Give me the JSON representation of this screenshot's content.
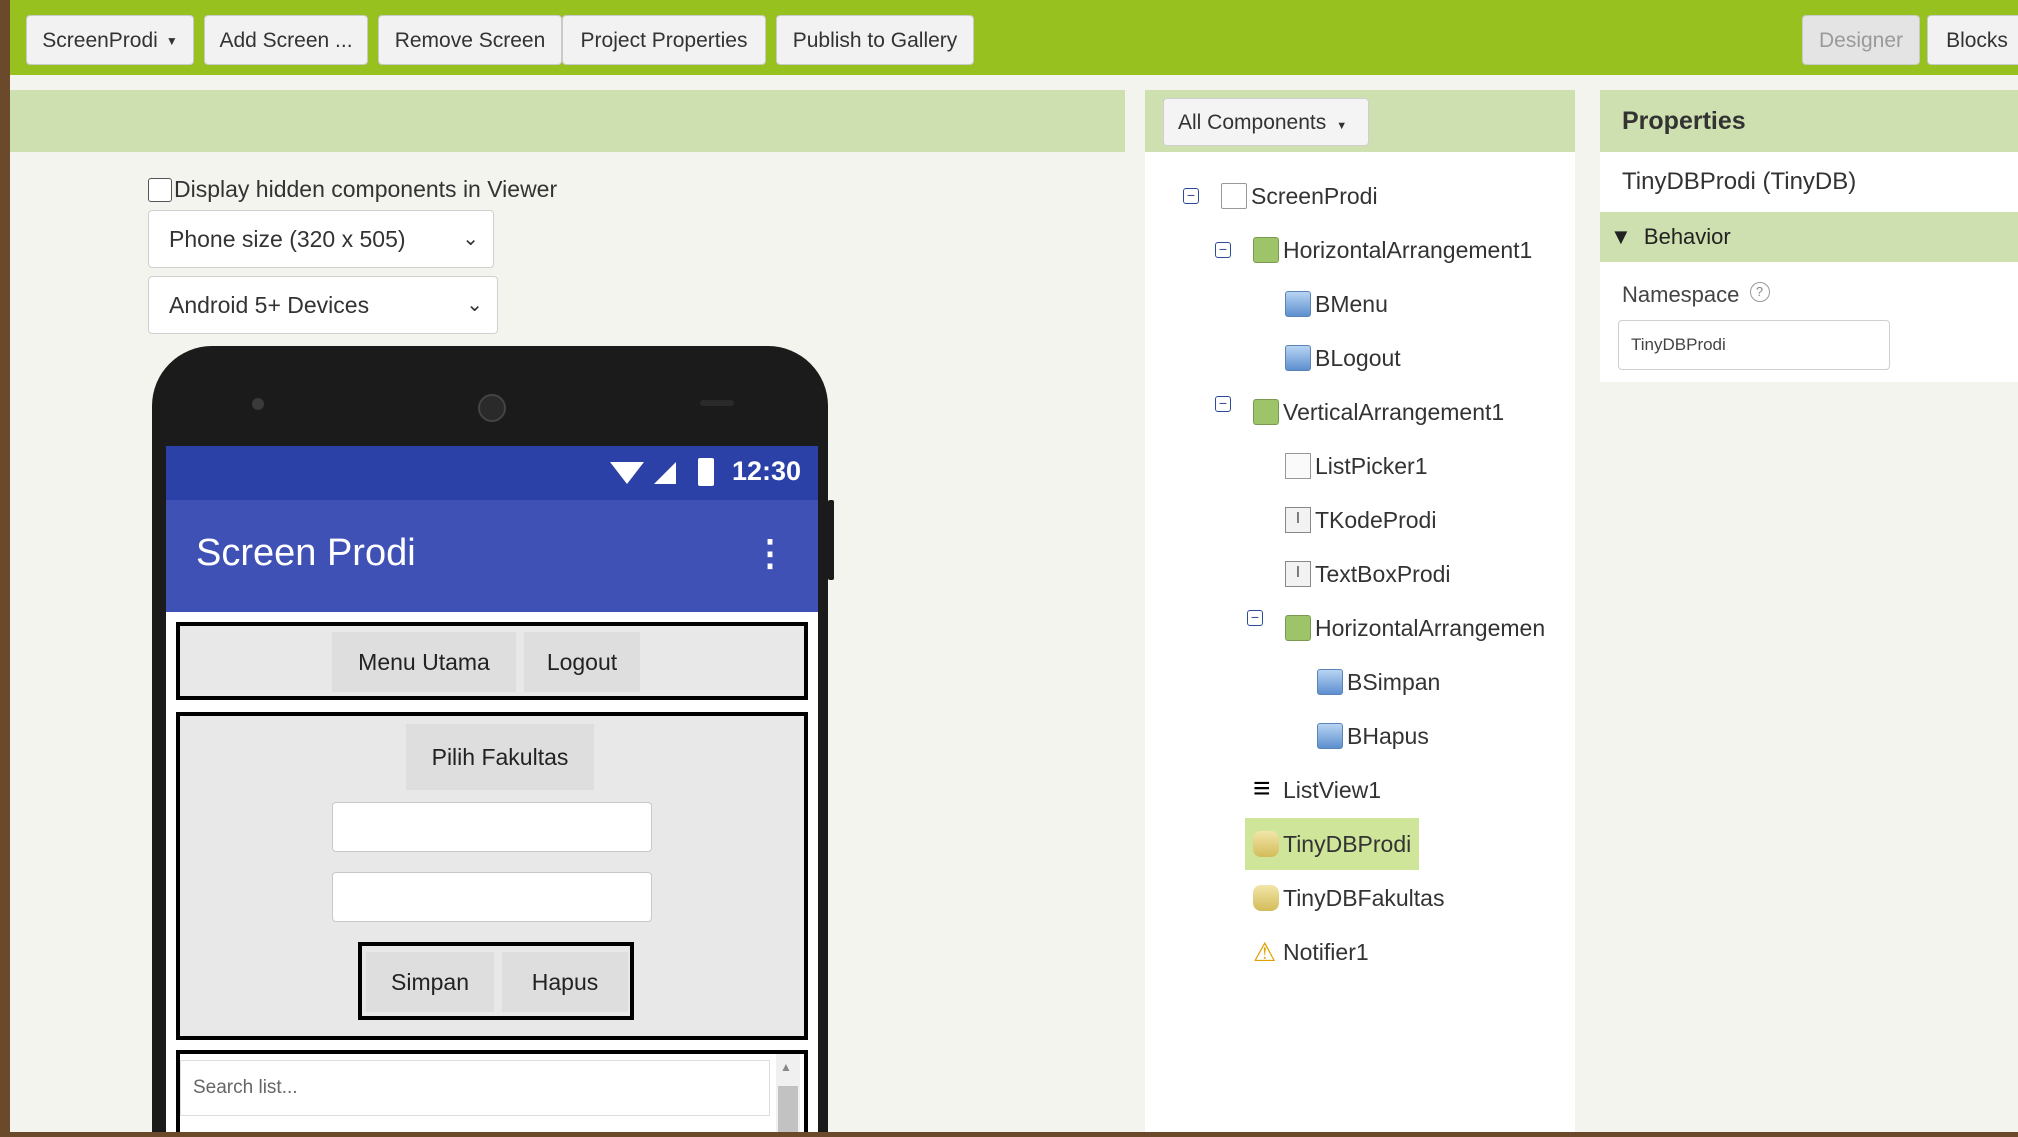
{
  "toolbar": {
    "screen_select": "ScreenProdi",
    "add_screen": "Add Screen ...",
    "remove_screen": "Remove Screen",
    "project_properties": "Project Properties",
    "publish_gallery": "Publish to Gallery",
    "designer": "Designer",
    "blocks": "Blocks"
  },
  "viewer": {
    "display_hidden_label": "Display hidden components in Viewer",
    "display_hidden_checked": false,
    "phone_size": "Phone size (320 x 505)",
    "android_version": "Android 5+ Devices"
  },
  "phone": {
    "clock": "12:30",
    "app_title": "Screen Prodi",
    "menu_utama": "Menu Utama",
    "logout": "Logout",
    "pilih_fakultas": "Pilih Fakultas",
    "simpan": "Simpan",
    "hapus": "Hapus",
    "search_placeholder": "Search list..."
  },
  "components": {
    "filter": "All Components",
    "tree": [
      {
        "label": "ScreenProdi",
        "icon": "screen-icon"
      },
      {
        "label": "HorizontalArrangement1",
        "icon": "horizontal-arrangement-icon"
      },
      {
        "label": "BMenu",
        "icon": "button-icon"
      },
      {
        "label": "BLogout",
        "icon": "button-icon"
      },
      {
        "label": "VerticalArrangement1",
        "icon": "vertical-arrangement-icon"
      },
      {
        "label": "ListPicker1",
        "icon": "listpicker-icon"
      },
      {
        "label": "TKodeProdi",
        "icon": "textbox-icon"
      },
      {
        "label": "TextBoxProdi",
        "icon": "textbox-icon"
      },
      {
        "label": "HorizontalArrangemen",
        "icon": "horizontal-arrangement-icon"
      },
      {
        "label": "BSimpan",
        "icon": "button-icon"
      },
      {
        "label": "BHapus",
        "icon": "button-icon"
      },
      {
        "label": "ListView1",
        "icon": "listview-icon"
      },
      {
        "label": "TinyDBProdi",
        "icon": "tinydb-icon",
        "selected": true
      },
      {
        "label": "TinyDBFakultas",
        "icon": "tinydb-icon"
      },
      {
        "label": "Notifier1",
        "icon": "notifier-icon"
      }
    ]
  },
  "properties": {
    "title": "Properties",
    "component": "TinyDBProdi (TinyDB)",
    "section": "Behavior",
    "namespace_label": "Namespace",
    "namespace_help": "?",
    "namespace_value": "TinyDBProdi"
  },
  "colors": {
    "toolbar_green": "#96c11f",
    "header_green": "#cfe0b0",
    "phone_status": "#2c41a7",
    "phone_appbar": "#3f51b5",
    "selected_node": "#cfe59a"
  }
}
